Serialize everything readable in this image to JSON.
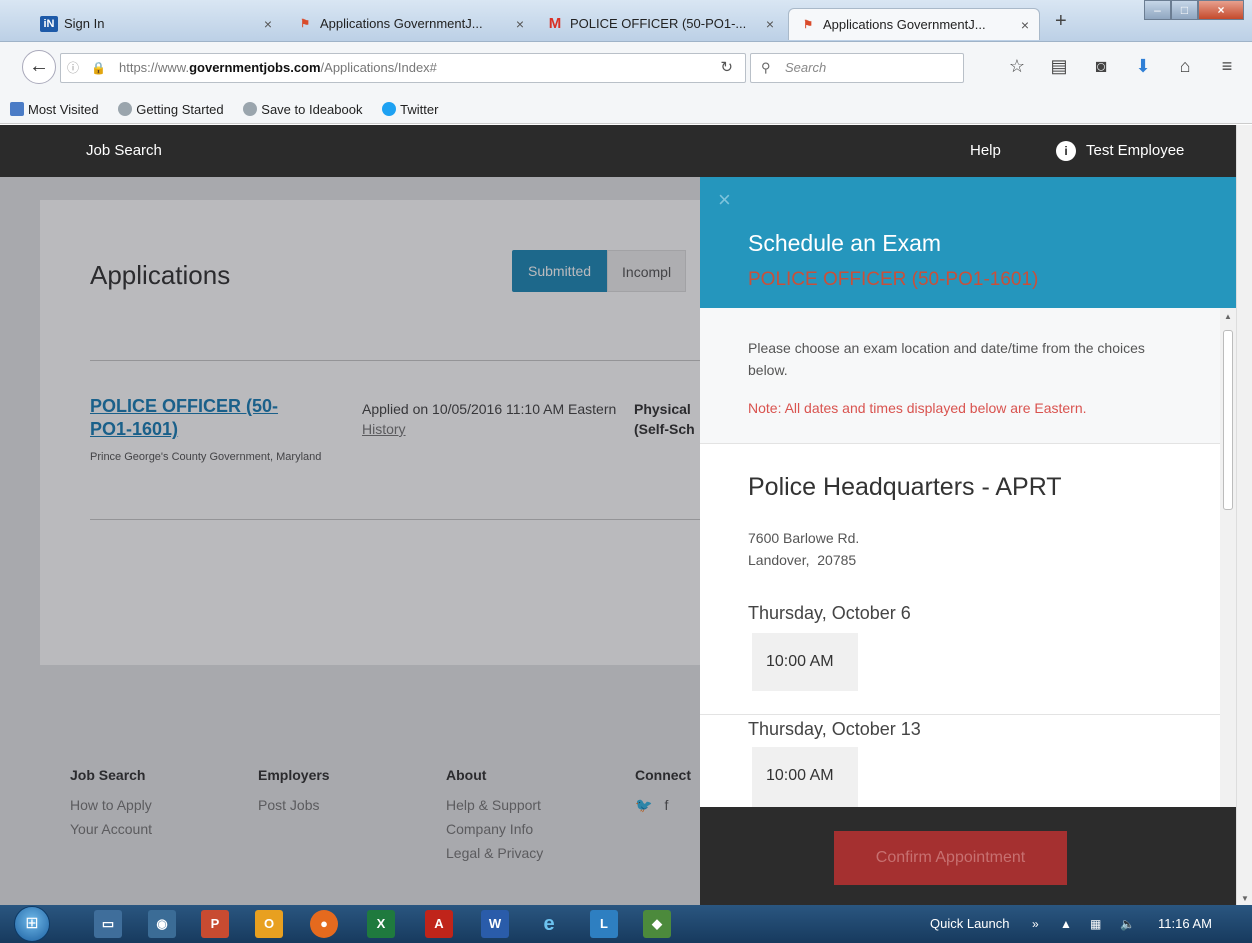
{
  "browser": {
    "tabs": [
      {
        "title": "Sign In",
        "favicon": "indeed-icon"
      },
      {
        "title": "Applications GovernmentJ...",
        "favicon": "flag-icon"
      },
      {
        "title": "POLICE OFFICER (50-PO1-...",
        "favicon": "gmail-icon"
      },
      {
        "title": "Applications GovernmentJ...",
        "favicon": "flag-icon",
        "active": true
      }
    ],
    "url_prefix": "https://www.",
    "url_domain": "governmentjobs.com",
    "url_path": "/Applications/Index#",
    "search_placeholder": "Search",
    "bookmarks": [
      "Most Visited",
      "Getting Started",
      "Save to Ideabook",
      "Twitter"
    ]
  },
  "site_nav": {
    "job_search": "Job Search",
    "help": "Help",
    "user": "Test Employee"
  },
  "applications": {
    "heading": "Applications",
    "tab_submitted": "Submitted",
    "tab_incomplete": "Incompl",
    "item": {
      "title": "POLICE OFFICER (50-PO1-1601)",
      "org": "Prince George's County Government, Maryland",
      "applied": "Applied on 10/05/2016 11:10 AM Eastern",
      "history": "History",
      "status": "Physical (Self-Sch"
    }
  },
  "footer": {
    "col1": {
      "title": "Job Search",
      "links": [
        "How to Apply",
        "Your Account"
      ]
    },
    "col2": {
      "title": "Employers",
      "links": [
        "Post Jobs"
      ]
    },
    "col3": {
      "title": "About",
      "links": [
        "Help & Support",
        "Company Info",
        "Legal & Privacy"
      ]
    },
    "col4": {
      "title": "Connect"
    }
  },
  "exam_panel": {
    "close": "×",
    "title": "Schedule an Exam",
    "subtitle": "POLICE OFFICER (50-PO1-1601)",
    "intro": "Please choose an exam location and date/time from the choices below.",
    "note": "Note: All dates and times displayed below are Eastern.",
    "location": {
      "name": "Police Headquarters - APRT",
      "address1": "7600 Barlowe Rd.",
      "address2": "Landover,  20785"
    },
    "dates": [
      {
        "day": "Thursday, October 6",
        "time": "10:00 AM"
      },
      {
        "day": "Thursday, October 13",
        "time": "10:00 AM"
      }
    ],
    "confirm": "Confirm Appointment"
  },
  "taskbar": {
    "quick_launch": "Quick Launch",
    "clock": "11:16 AM"
  },
  "colors": {
    "accent": "#2596bd",
    "danger": "#d9534f",
    "nav": "#2b2b2b"
  }
}
